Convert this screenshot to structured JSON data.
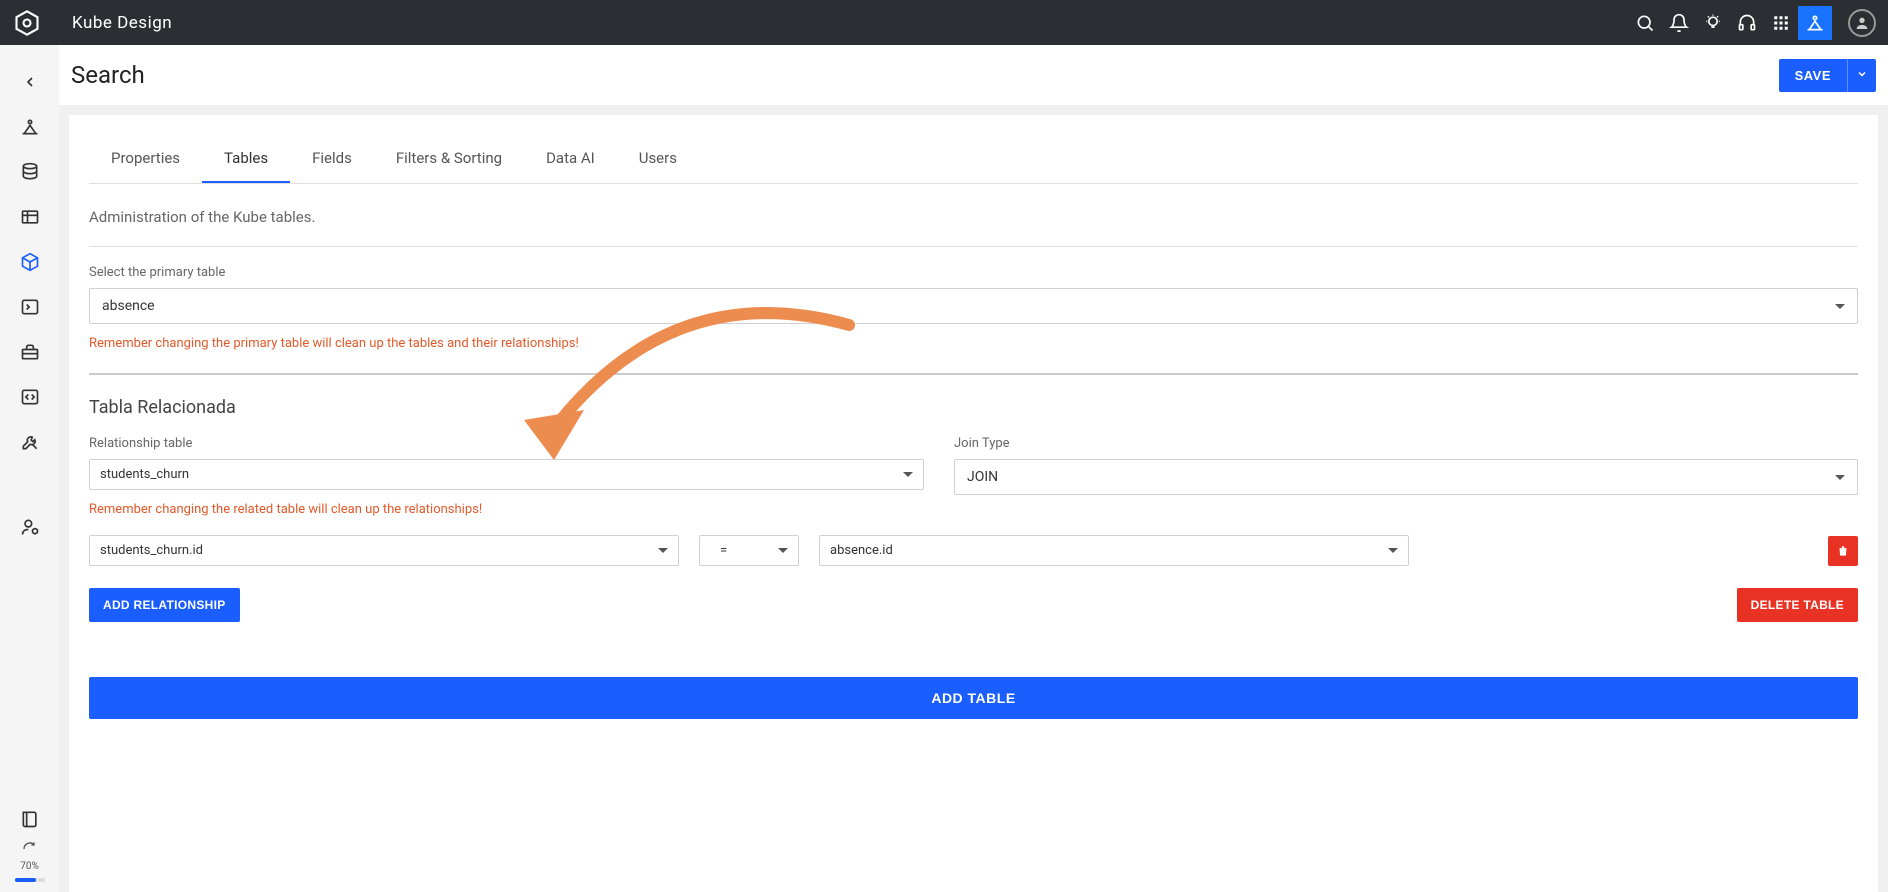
{
  "brand": "Kube Design",
  "page_title": "Search",
  "save_label": "SAVE",
  "tabs": [
    "Properties",
    "Tables",
    "Fields",
    "Filters & Sorting",
    "Data AI",
    "Users"
  ],
  "active_tab_index": 1,
  "section_desc": "Administration of the Kube tables.",
  "primary": {
    "label": "Select the primary table",
    "value": "absence",
    "warning": "Remember changing the primary table will clean up the tables and their relationships!"
  },
  "related": {
    "title": "Tabla Relacionada",
    "table_label": "Relationship table",
    "table_value": "students_churn",
    "join_label": "Join Type",
    "join_value": "JOIN",
    "warning": "Remember changing the related table will clean up the relationships!",
    "row": {
      "left": "students_churn.id",
      "op": "=",
      "right": "absence.id"
    }
  },
  "buttons": {
    "add_relationship": "ADD RELATIONSHIP",
    "delete_table": "DELETE TABLE",
    "add_table": "ADD TABLE"
  },
  "zoom": "70%"
}
